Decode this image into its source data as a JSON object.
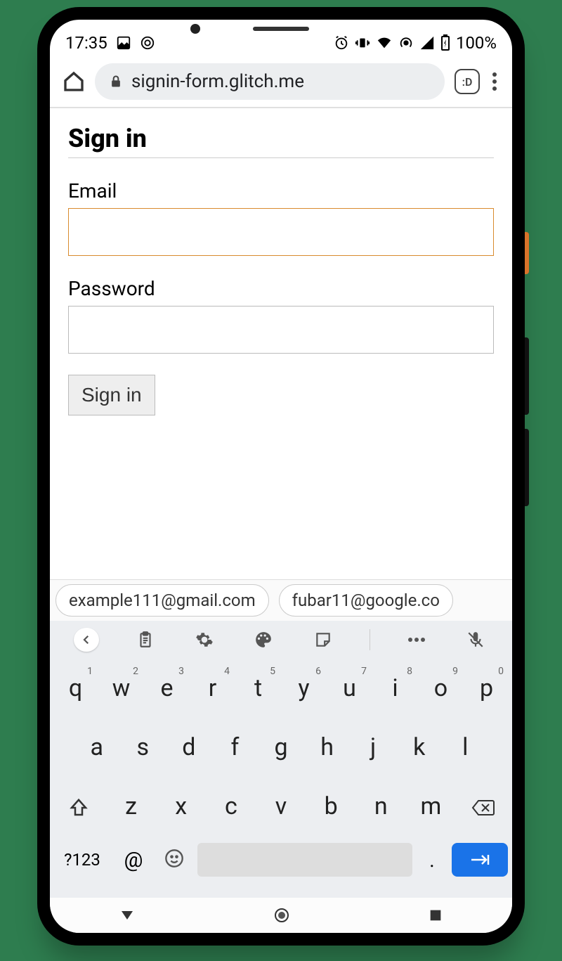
{
  "status": {
    "time": "17:35",
    "battery": "100%"
  },
  "browser": {
    "url": "signin-form.glitch.me",
    "tab_badge": ":D"
  },
  "page": {
    "heading": "Sign in",
    "email_label": "Email",
    "email_value": "",
    "password_label": "Password",
    "password_value": "",
    "submit_label": "Sign in"
  },
  "suggestions": [
    "example111@gmail.com",
    "fubar11@google.co"
  ],
  "keyboard": {
    "row1": [
      {
        "k": "q",
        "n": "1"
      },
      {
        "k": "w",
        "n": "2"
      },
      {
        "k": "e",
        "n": "3"
      },
      {
        "k": "r",
        "n": "4"
      },
      {
        "k": "t",
        "n": "5"
      },
      {
        "k": "y",
        "n": "6"
      },
      {
        "k": "u",
        "n": "7"
      },
      {
        "k": "i",
        "n": "8"
      },
      {
        "k": "o",
        "n": "9"
      },
      {
        "k": "p",
        "n": "0"
      }
    ],
    "row2": [
      "a",
      "s",
      "d",
      "f",
      "g",
      "h",
      "j",
      "k",
      "l"
    ],
    "row3": [
      "z",
      "x",
      "c",
      "v",
      "b",
      "n",
      "m"
    ],
    "sym": "?123",
    "at": "@",
    "dot": "."
  }
}
